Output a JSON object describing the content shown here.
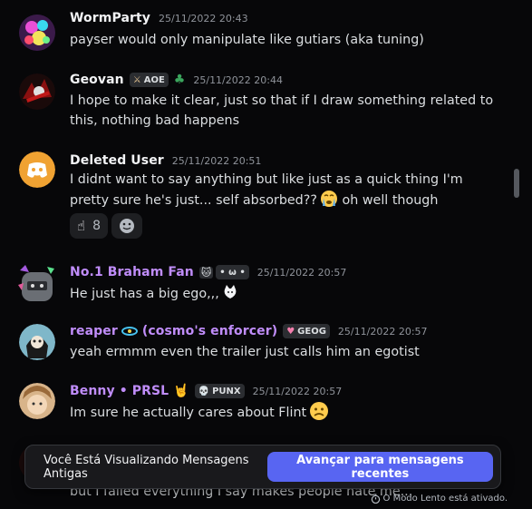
{
  "messages": [
    {
      "username": "WormParty",
      "timestamp": "25/11/2022 20:43",
      "text": "payser would only manipulate  like  gutiars (aka tuning)"
    },
    {
      "username": "Geovan",
      "tag": "AOE",
      "timestamp": "25/11/2022 20:44",
      "text": "I hope to make it clear, just so that if I draw something related to this, nothing bad happens"
    },
    {
      "username": "Deleted User",
      "timestamp": "25/11/2022 20:51",
      "text": "I didnt want to say anything but like just as a quick thing I'm pretty sure he's just... self absorbed??",
      "text_after_emoji": " oh well though",
      "reaction_count": "8"
    },
    {
      "username": "No.1 Braham Fan",
      "tag": "• ω •",
      "timestamp": "25/11/2022 20:57",
      "text": "He just has a big ego,,,"
    },
    {
      "username": "reaper",
      "username_suffix": "(cosmo's enforcer)",
      "tag": "GEOG",
      "timestamp": "25/11/2022 20:57",
      "text": "yeah ermmm even the trailer just calls him an egotist"
    },
    {
      "username": "Benny • PRSL",
      "tag": "PUNX",
      "timestamp": "25/11/2022 20:57",
      "text": "Im sure he actually cares about Flint"
    },
    {
      "text": "but I failed everything I say makes people hate me..."
    }
  ],
  "banner": {
    "text": "Você Está Visualizando Mensagens Antigas",
    "button": "Avançar para mensagens recentes"
  },
  "slowmode": "O Modo Lento está ativado.",
  "colors": {
    "accent": "#5865f2",
    "purple_name": "#c08dfa",
    "background": "#070709"
  }
}
